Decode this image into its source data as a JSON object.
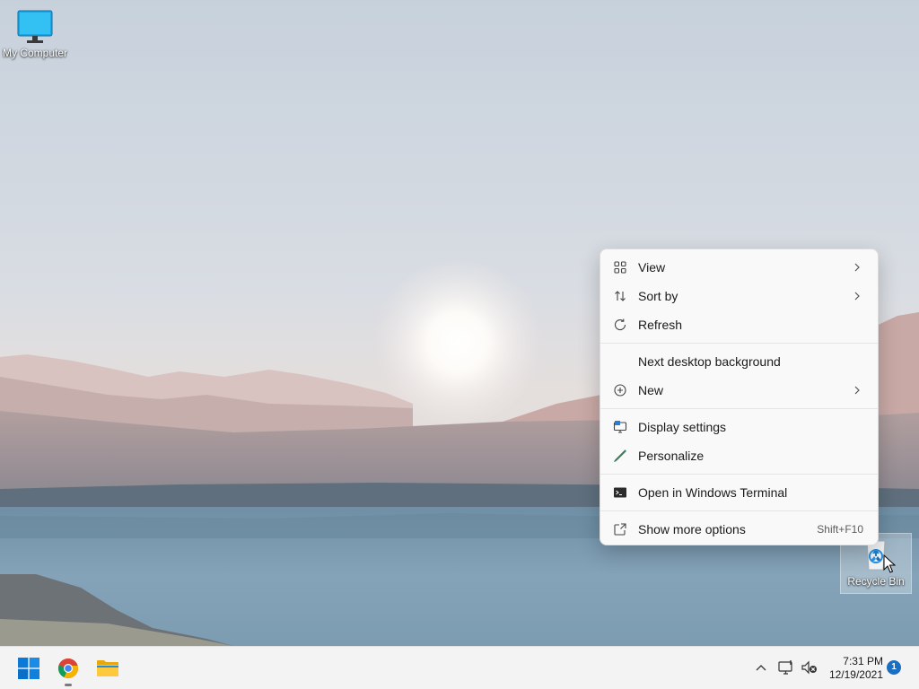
{
  "desktop": {
    "icons": [
      {
        "label": "My Computer",
        "icon": "monitor-icon"
      },
      {
        "label": "Recycle Bin",
        "icon": "recycle-bin-icon"
      }
    ]
  },
  "context_menu": {
    "items": [
      {
        "label": "View",
        "icon": "grid-icon",
        "submenu": true
      },
      {
        "label": "Sort by",
        "icon": "sort-icon",
        "submenu": true
      },
      {
        "label": "Refresh",
        "icon": "refresh-icon"
      },
      {
        "label": "Next desktop background",
        "icon": ""
      },
      {
        "label": "New",
        "icon": "add-circle-icon",
        "submenu": true
      },
      {
        "label": "Display settings",
        "icon": "display-icon"
      },
      {
        "label": "Personalize",
        "icon": "brush-icon"
      },
      {
        "label": "Open in Windows Terminal",
        "icon": "terminal-icon"
      },
      {
        "label": "Show more options",
        "icon": "expand-icon",
        "shortcut": "Shift+F10"
      }
    ]
  },
  "taskbar": {
    "apps": [
      {
        "name": "Start",
        "icon": "windows-logo-icon"
      },
      {
        "name": "Google Chrome",
        "icon": "chrome-icon",
        "running": true
      },
      {
        "name": "File Explorer",
        "icon": "folder-icon"
      }
    ],
    "tray": {
      "icons": [
        "chevron-up-icon",
        "network-icon",
        "volume-muted-icon"
      ],
      "time": "7:31 PM",
      "date": "12/19/2021",
      "notification_count": "1"
    }
  },
  "colors": {
    "accent": "#0078d4",
    "taskbar_bg": "#f3f3f3",
    "menu_bg": "#f9f9f9"
  }
}
